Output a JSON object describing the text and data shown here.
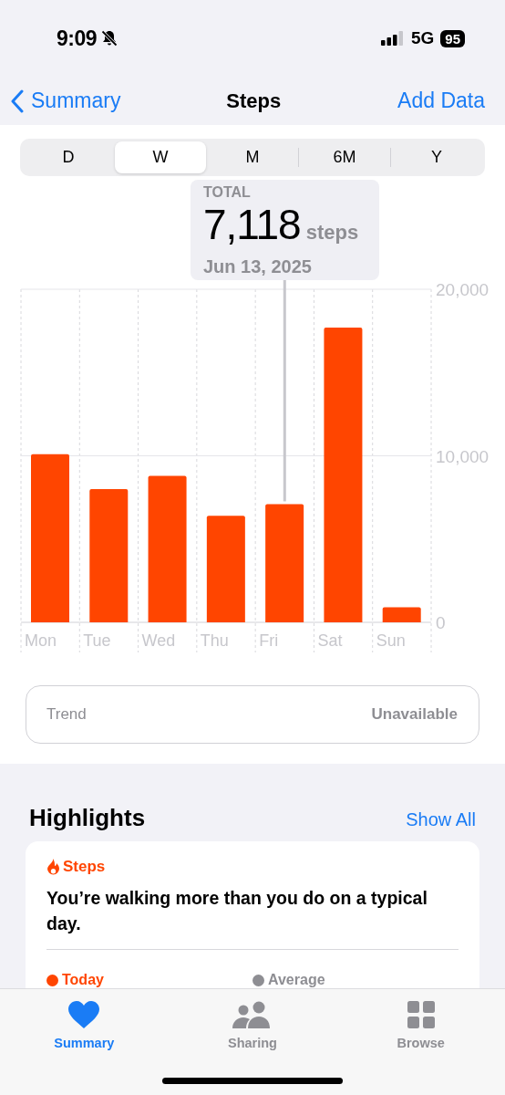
{
  "status_bar": {
    "time": "9:09",
    "network": "5G",
    "battery": "95"
  },
  "nav": {
    "back": "Summary",
    "title": "Steps",
    "action": "Add Data"
  },
  "range_tabs": [
    {
      "label": "D",
      "selected": false
    },
    {
      "label": "W",
      "selected": true
    },
    {
      "label": "M",
      "selected": false
    },
    {
      "label": "6M",
      "selected": false
    },
    {
      "label": "Y",
      "selected": false
    }
  ],
  "callout": {
    "label": "TOTAL",
    "value": "7,118",
    "unit": "steps",
    "date": "Jun 13, 2025"
  },
  "chart_data": {
    "type": "bar",
    "categories": [
      "Mon",
      "Tue",
      "Wed",
      "Thu",
      "Fri",
      "Sat",
      "Sun"
    ],
    "series": [
      {
        "color": "#ff4500",
        "values": [
          10100,
          8000,
          8800,
          6400,
          7100,
          17700,
          900
        ]
      }
    ],
    "ylim": [
      0,
      20000
    ],
    "yticks": [
      {
        "value": 0,
        "label": "0"
      },
      {
        "value": 10000,
        "label": "10,000"
      },
      {
        "value": 20000,
        "label": "20,000"
      }
    ]
  },
  "bars": [
    {
      "selected": false
    },
    {
      "selected": false
    },
    {
      "selected": false
    },
    {
      "selected": false
    },
    {
      "selected": true
    },
    {
      "selected": false
    },
    {
      "selected": false
    }
  ],
  "trend": {
    "label": "Trend",
    "value": "Unavailable"
  },
  "highlights": {
    "title": "Highlights",
    "action": "Show All",
    "card": {
      "category": "Steps",
      "message": "You’re walking more than you do on a typical day.",
      "legend": [
        {
          "label": "Today",
          "color": "#ff4500"
        },
        {
          "label": "Average",
          "color": "#8e8e93"
        }
      ]
    }
  },
  "tab_bar": [
    {
      "label": "Summary",
      "selected": true
    },
    {
      "label": "Sharing",
      "selected": false
    },
    {
      "label": "Browse",
      "selected": false
    }
  ]
}
